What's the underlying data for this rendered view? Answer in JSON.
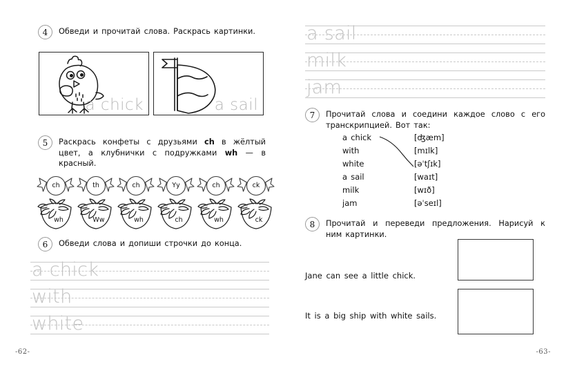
{
  "pages": {
    "left_number": "-62-",
    "right_number": "-63-"
  },
  "exercises": {
    "ex4": {
      "number": "4",
      "text": "Обведи и прочитай слова. Раскрась картинки.",
      "pictures": [
        {
          "name": "chick-drawing",
          "label": "a chick"
        },
        {
          "name": "sail-drawing",
          "label": "a sail"
        }
      ]
    },
    "ex5": {
      "number": "5",
      "text_part1": "Раскрась конфеты с друзьями ",
      "text_bold1": "ch",
      "text_part2": " в жёлтый цвет, а клубнички с подружками ",
      "text_bold2": "wh",
      "text_part3": " — в красный.",
      "candies": [
        "ch",
        "th",
        "ch",
        "Yy",
        "ch",
        "ck"
      ],
      "strawberries": [
        "wh",
        "Ww",
        "wh",
        "ch",
        "wh",
        "ck"
      ]
    },
    "ex6": {
      "number": "6",
      "text": "Обведи слова и допиши строчки до конца.",
      "lines_left": [
        "a chick",
        "with",
        "white"
      ],
      "lines_right": [
        "a sail",
        "milk",
        "jam"
      ]
    },
    "ex7": {
      "number": "7",
      "text": "Прочитай слова и соедини каждое слово с его транскрипцией. Вот так:",
      "words": [
        "a chick",
        "with",
        "white",
        "a sail",
        "milk",
        "jam"
      ],
      "transcriptions": [
        "[ʤæm]",
        "[mɪlk]",
        "[əˈtʃɪk]",
        "[waɪt]",
        "[wɪð]",
        "[əˈseɪl]"
      ],
      "example_link": {
        "from_word_index": 0,
        "to_transcription_index": 2
      }
    },
    "ex8": {
      "number": "8",
      "text": "Прочитай и переведи предложения. Нарисуй к ним картинки.",
      "sentences": [
        "Jane can see a little chick.",
        "It is a big ship with white sails."
      ],
      "draw_boxes": [
        "drawing-box-1",
        "drawing-box-2"
      ]
    }
  },
  "colors": {
    "ink": "#1a1a1a",
    "trace_gray": "#c2c2c2",
    "rule_gray": "#c9c9c9",
    "frame": "#2b2b2b"
  }
}
